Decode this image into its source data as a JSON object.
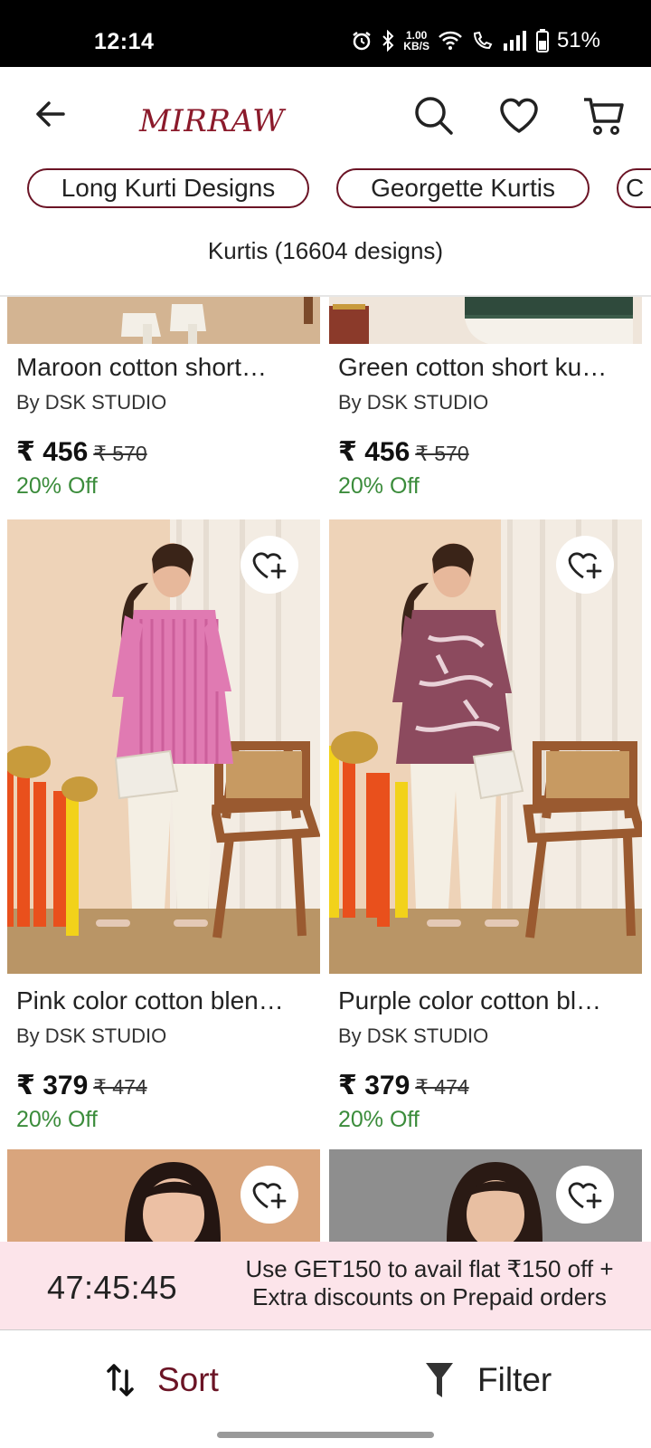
{
  "status_bar": {
    "time": "12:14",
    "net_speed_value": "1.00",
    "net_speed_unit": "KB/S",
    "battery": "51%",
    "icons": [
      "alarm-icon",
      "bluetooth-icon",
      "wifi-icon",
      "wifi-call-icon",
      "signal-icon",
      "battery-icon"
    ]
  },
  "header": {
    "logo_text": "MIRRAW",
    "brand_color": "#8b1a2b",
    "icons": [
      "back-arrow-icon",
      "search-icon",
      "heart-icon",
      "cart-icon"
    ]
  },
  "chips": [
    {
      "label": "Long Kurti Designs"
    },
    {
      "label": "Georgette Kurtis"
    },
    {
      "label": "C"
    }
  ],
  "result_count": "Kurtis (16604 designs)",
  "products": [
    {
      "title": "Maroon cotton short…",
      "brand": "By DSK STUDIO",
      "price": "₹ 456",
      "mrp": "₹ 570",
      "discount": "20% Off"
    },
    {
      "title": "Green cotton short ku…",
      "brand": "By DSK STUDIO",
      "price": "₹ 456",
      "mrp": "₹ 570",
      "discount": "20% Off"
    },
    {
      "title": "Pink color cotton blen…",
      "brand": "By DSK STUDIO",
      "price": "₹ 379",
      "mrp": "₹ 474",
      "discount": "20% Off"
    },
    {
      "title": "Purple color cotton bl…",
      "brand": "By DSK STUDIO",
      "price": "₹ 379",
      "mrp": "₹ 474",
      "discount": "20% Off"
    }
  ],
  "promo": {
    "timer": "47:45:45",
    "message_line1": "Use GET150 to avail flat ₹150 off +",
    "message_line2": "Extra discounts on Prepaid orders",
    "background": "#fce4ea"
  },
  "bottom_bar": {
    "sort_label": "Sort",
    "filter_label": "Filter",
    "sort_color": "#6b1425"
  },
  "colors": {
    "accent": "#6b1425",
    "discount_green": "#3b8c3b"
  }
}
